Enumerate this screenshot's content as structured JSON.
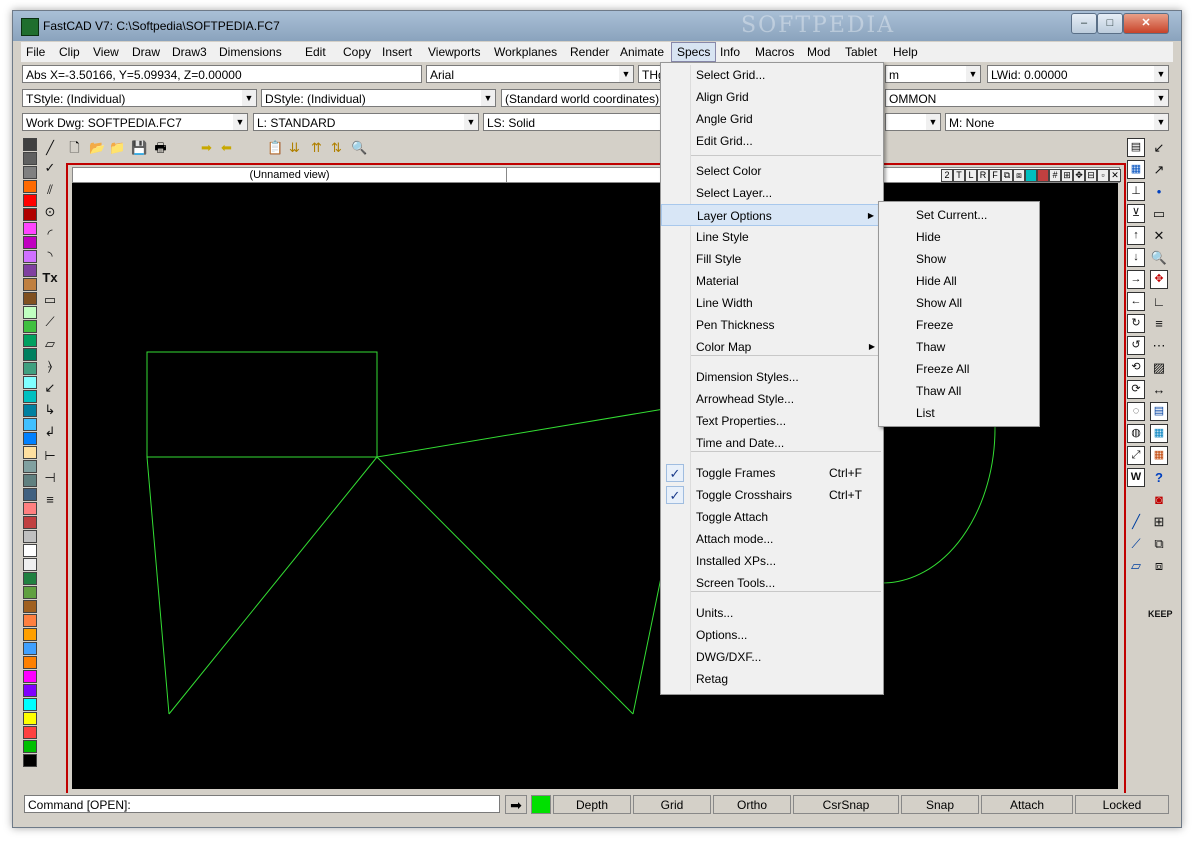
{
  "window": {
    "title": "FastCAD V7: C:\\Softpedia\\SOFTPEDIA.FC7",
    "watermark": "SOFTPEDIA",
    "minimize": "–",
    "maximize": "□",
    "close": "✕"
  },
  "menubar": {
    "items": [
      "File",
      "Clip",
      "View",
      "Draw",
      "Draw3",
      "Dimensions",
      "Edit",
      "Copy",
      "Insert",
      "Viewports",
      "Workplanes",
      "Render",
      "Animate",
      "Specs",
      "Info",
      "Macros",
      "Mod",
      "Tablet",
      "Help"
    ],
    "active": "Specs"
  },
  "toolbar_fields": {
    "coords": "Abs X=-3.50166, Y=5.09934, Z=0.00000",
    "font": "Arial",
    "th": "THg",
    "m_field": "m",
    "lwid": "LWid: 0.00000",
    "tstyle": "TStyle: (Individual)",
    "dstyle": "DStyle: (Individual)",
    "coord_sys": "(Standard world coordinates)",
    "common": "OMMON",
    "work_dwg": "Work Dwg: SOFTPEDIA.FC7",
    "layer": "L: STANDARD",
    "linestyle": "LS: Solid",
    "material": "M: None"
  },
  "viewport": {
    "title": "(Unnamed view)",
    "buttons": [
      "2",
      "T",
      "L",
      "R",
      "F"
    ]
  },
  "specs_menu": {
    "items": [
      {
        "label": "Select Grid...",
        "shortcut": "",
        "checked": false,
        "submenu": false
      },
      {
        "label": "Align Grid",
        "shortcut": "",
        "checked": false,
        "submenu": false
      },
      {
        "label": "Angle Grid",
        "shortcut": "",
        "checked": false,
        "submenu": false
      },
      {
        "label": "Edit Grid...",
        "shortcut": "",
        "checked": false,
        "submenu": false
      },
      {
        "label": "Select Color",
        "shortcut": "",
        "checked": false,
        "submenu": false
      },
      {
        "label": "Select Layer...",
        "shortcut": "",
        "checked": false,
        "submenu": false
      },
      {
        "label": "Layer Options",
        "shortcut": "",
        "checked": false,
        "submenu": true
      },
      {
        "label": "Line Style",
        "shortcut": "",
        "checked": false,
        "submenu": false
      },
      {
        "label": "Fill Style",
        "shortcut": "",
        "checked": false,
        "submenu": false
      },
      {
        "label": "Material",
        "shortcut": "",
        "checked": false,
        "submenu": false
      },
      {
        "label": "Line Width",
        "shortcut": "",
        "checked": false,
        "submenu": false
      },
      {
        "label": "Pen Thickness",
        "shortcut": "",
        "checked": false,
        "submenu": false
      },
      {
        "label": "Color Map",
        "shortcut": "",
        "checked": false,
        "submenu": true
      },
      {
        "label": "Dimension Styles...",
        "shortcut": "",
        "checked": false,
        "submenu": false
      },
      {
        "label": "Arrowhead Style...",
        "shortcut": "",
        "checked": false,
        "submenu": false
      },
      {
        "label": "Text Properties...",
        "shortcut": "",
        "checked": false,
        "submenu": false
      },
      {
        "label": "Time and Date...",
        "shortcut": "",
        "checked": false,
        "submenu": false
      },
      {
        "label": "Toggle Frames",
        "shortcut": "Ctrl+F",
        "checked": true,
        "submenu": false
      },
      {
        "label": "Toggle Crosshairs",
        "shortcut": "Ctrl+T",
        "checked": true,
        "submenu": false
      },
      {
        "label": "Toggle Attach",
        "shortcut": "",
        "checked": false,
        "submenu": false
      },
      {
        "label": "Attach mode...",
        "shortcut": "",
        "checked": false,
        "submenu": false
      },
      {
        "label": "Installed XPs...",
        "shortcut": "",
        "checked": false,
        "submenu": false
      },
      {
        "label": "Screen Tools...",
        "shortcut": "",
        "checked": false,
        "submenu": false
      },
      {
        "label": "Units...",
        "shortcut": "",
        "checked": false,
        "submenu": false
      },
      {
        "label": "Options...",
        "shortcut": "",
        "checked": false,
        "submenu": false
      },
      {
        "label": "DWG/DXF...",
        "shortcut": "",
        "checked": false,
        "submenu": false
      },
      {
        "label": "Retag",
        "shortcut": "",
        "checked": false,
        "submenu": false
      }
    ],
    "highlighted": "Layer Options"
  },
  "layer_options_submenu": {
    "items": [
      "Set Current...",
      "Hide",
      "Show",
      "Hide All",
      "Show All",
      "Freeze",
      "Thaw",
      "Freeze All",
      "Thaw All",
      "List"
    ]
  },
  "left_tools": [
    "╱",
    "✓",
    "⫽",
    "⊙",
    "◜",
    "◝",
    "Tx",
    "▭",
    "⟋",
    "▱",
    "⦒",
    "↙",
    "↳",
    "↲",
    "⊢",
    "⊣",
    "≡"
  ],
  "status": {
    "command": "Command [OPEN]:",
    "buttons": [
      "Depth",
      "Grid",
      "Ortho",
      "CsrSnap",
      "Snap",
      "Attach",
      "Locked"
    ],
    "color_indicator": "#00e000"
  },
  "colors": {
    "canvas_bg": "#000000",
    "drawing": "#33dd33",
    "viewport_border": "#c00000",
    "menu_highlight": "#d8e6f6"
  },
  "palette": [
    "#404040",
    "#606060",
    "#808080",
    "#ff6a00",
    "#ff0000",
    "#b00000",
    "#ff44ff",
    "#c000c0",
    "#d070ff",
    "#8040a0",
    "#c08040",
    "#805020",
    "#c0ffc0",
    "#40c040",
    "#00a060",
    "#008060",
    "#40a080",
    "#80ffff",
    "#00c0c0",
    "#0080a0",
    "#40c0ff",
    "#0080ff",
    "#ffe0a0",
    "#80a0a0",
    "#608080",
    "#406080",
    "#ff8080",
    "#c04040",
    "#c0c0c0",
    "#ffffff",
    "#f0f0f0",
    "#208040",
    "#60a040",
    "#a06020",
    "#ff8040",
    "#ffa000",
    "#40a0ff",
    "#ff8000",
    "#ff00ff",
    "#8000ff",
    "#00ffff",
    "#ffff00",
    "#ff4040",
    "#00c000",
    "#000000"
  ]
}
